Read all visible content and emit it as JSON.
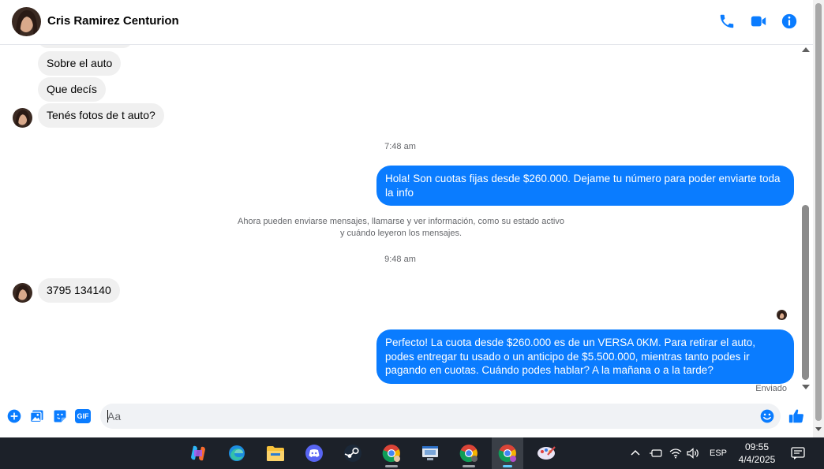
{
  "header": {
    "contact_name": "Cris Ramirez Centurion"
  },
  "messages": {
    "incoming_1": "Sobre el auto",
    "incoming_2": "Que decís",
    "incoming_3": "Tenés fotos de t auto?",
    "timestamp_1": "7:48 am",
    "outgoing_1": "Hola! Son cuotas fijas desde $260.000. Dejame tu número para poder enviarte toda la info",
    "system_note_line1": "Ahora pueden enviarse mensajes, llamarse y ver información, como su estado activo",
    "system_note_line2": "y cuándo leyeron los mensajes.",
    "timestamp_2": "9:48 am",
    "incoming_4": "3795 134140",
    "outgoing_2": "Perfecto! La cuota desde $260.000 es de un VERSA 0KM. Para retirar el auto, podes entregar tu usado o un anticipo de $5.500.000, mientras tanto podes ir pagando en cuotas. Cuándo podes hablar? A la mañana o a la tarde?",
    "sent_status": "Enviado"
  },
  "composer": {
    "placeholder": "Aa",
    "gif_label": "GIF"
  },
  "taskbar": {
    "language": "ESP",
    "time": "09:55",
    "date": "4/4/2025"
  },
  "colors": {
    "accent": "#0a7cff",
    "incoming_bubble": "#f0f0f0",
    "taskbar": "#1c2129"
  }
}
